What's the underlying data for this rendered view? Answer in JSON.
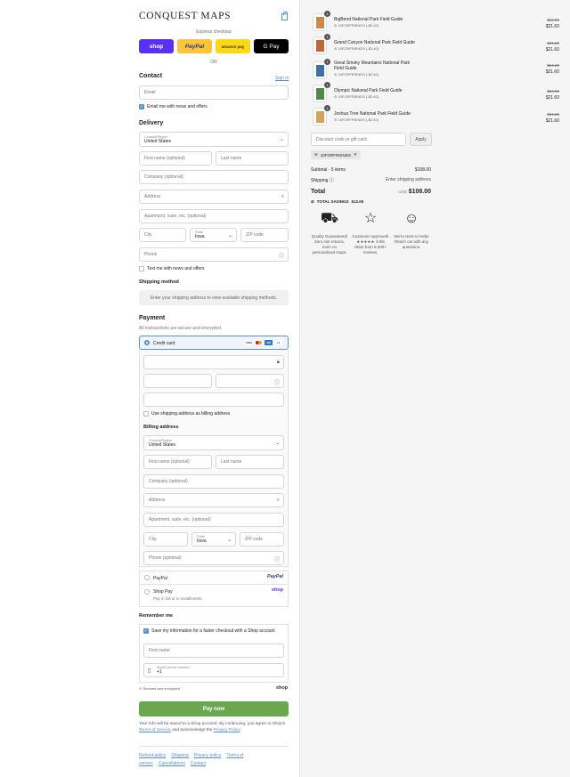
{
  "brand": {
    "logo": "CONQUEST MAPS"
  },
  "header": {
    "express_label": "Express checkout",
    "or_label": "OR"
  },
  "express_buttons": {
    "shop": "shop",
    "paypal": "PayPal",
    "amazon": "amazon pay",
    "gpay": "G Pay"
  },
  "contact": {
    "title": "Contact",
    "signin": "Sign in",
    "email_placeholder": "Email",
    "news_label": "Email me with news and offers"
  },
  "delivery": {
    "title": "Delivery",
    "country_label": "Country/Region",
    "country_value": "United States",
    "first_name": "First name (optional)",
    "last_name": "Last name",
    "company": "Company (optional)",
    "address": "Address",
    "apartment": "Apartment, suite, etc. (optional)",
    "city": "City",
    "state_label": "State",
    "state_value": "Iowa",
    "zip": "ZIP code",
    "phone": "Phone",
    "text_label": "Text me with news and offers"
  },
  "shipping": {
    "title": "Shipping method",
    "note": "Enter your shipping address to view available shipping methods."
  },
  "payment": {
    "title": "Payment",
    "subtitle": "All transactions are secure and encrypted.",
    "credit_card": "Credit card",
    "more_cards": "+3",
    "billing_same": "Use shipping address as billing address",
    "billing_title": "Billing address",
    "phone_optional": "Phone (optional)",
    "paypal": "PayPal",
    "paypal_logo": "PayPal",
    "shoppay": "Shop Pay",
    "shoppay_sub": "Pay in full or in installments",
    "shoppay_logo": "shop"
  },
  "remember": {
    "title": "Remember me",
    "save_label": "Save my information for a faster checkout with a Shop account",
    "first_name": "First name",
    "mobile_label": "Mobile phone number",
    "mobile_value": "+1",
    "secure": "Secured and encrypted",
    "shop_logo": "shop"
  },
  "paynow": "Pay now",
  "legal": {
    "text": "Your info will be saved to a Shop account. By continuing, you agree to Shop's",
    "tos": "Terms of Service",
    "and": "and acknowledge the",
    "privacy": "Privacy Policy"
  },
  "footer": [
    "Refund policy",
    "Shipping",
    "Privacy policy",
    "Terms of service",
    "Cancellations",
    "Contact"
  ],
  "items": [
    {
      "name": "BigBend National Park Field Guide",
      "discount": "10FORFRIENDS (-$2.40)",
      "old": "$24.00",
      "new": "$21.60",
      "qty": "1",
      "color": "#c98a4b"
    },
    {
      "name": "Grand Canyon National Park Field Guide",
      "discount": "10FORFRIENDS (-$2.40)",
      "old": "$24.00",
      "new": "$21.60",
      "qty": "1",
      "color": "#c0673a"
    },
    {
      "name": "Great Smoky Mountains National Park Field Guide",
      "discount": "10FORFRIENDS (-$2.40)",
      "old": "$24.00",
      "new": "$21.60",
      "qty": "1",
      "color": "#3e6fa6"
    },
    {
      "name": "Olympic National Park Field Guide",
      "discount": "10FORFRIENDS (-$2.40)",
      "old": "$24.00",
      "new": "$21.60",
      "qty": "1",
      "color": "#4f8a4a"
    },
    {
      "name": "Joshua Tree National Park Field Guide",
      "discount": "10FORFRIENDS (-$2.40)",
      "old": "$24.00",
      "new": "$21.60",
      "qty": "1",
      "color": "#d3a35a"
    }
  ],
  "summary": {
    "discount_placeholder": "Discount code or gift card",
    "apply": "Apply",
    "code": "10FORFRIENDS",
    "subtotal_label": "Subtotal · 5 items",
    "subtotal": "$108.00",
    "shipping_label": "Shipping",
    "shipping_value": "Enter shipping address",
    "total_label": "Total",
    "currency": "USD",
    "total": "$108.00",
    "savings_label": "TOTAL SAVINGS",
    "savings": "$12.00"
  },
  "perks": [
    {
      "icon": "truck-icon",
      "text": "Quality Guaranteed! Zero risk returns, even on personalized maps."
    },
    {
      "icon": "star-icon",
      "text": "Customer Approved! ★★★★★ 4.9/5 Stars from 5,000+ reviews."
    },
    {
      "icon": "chat-icon",
      "text": "We're Here to Help! Reach out with any questions."
    }
  ]
}
